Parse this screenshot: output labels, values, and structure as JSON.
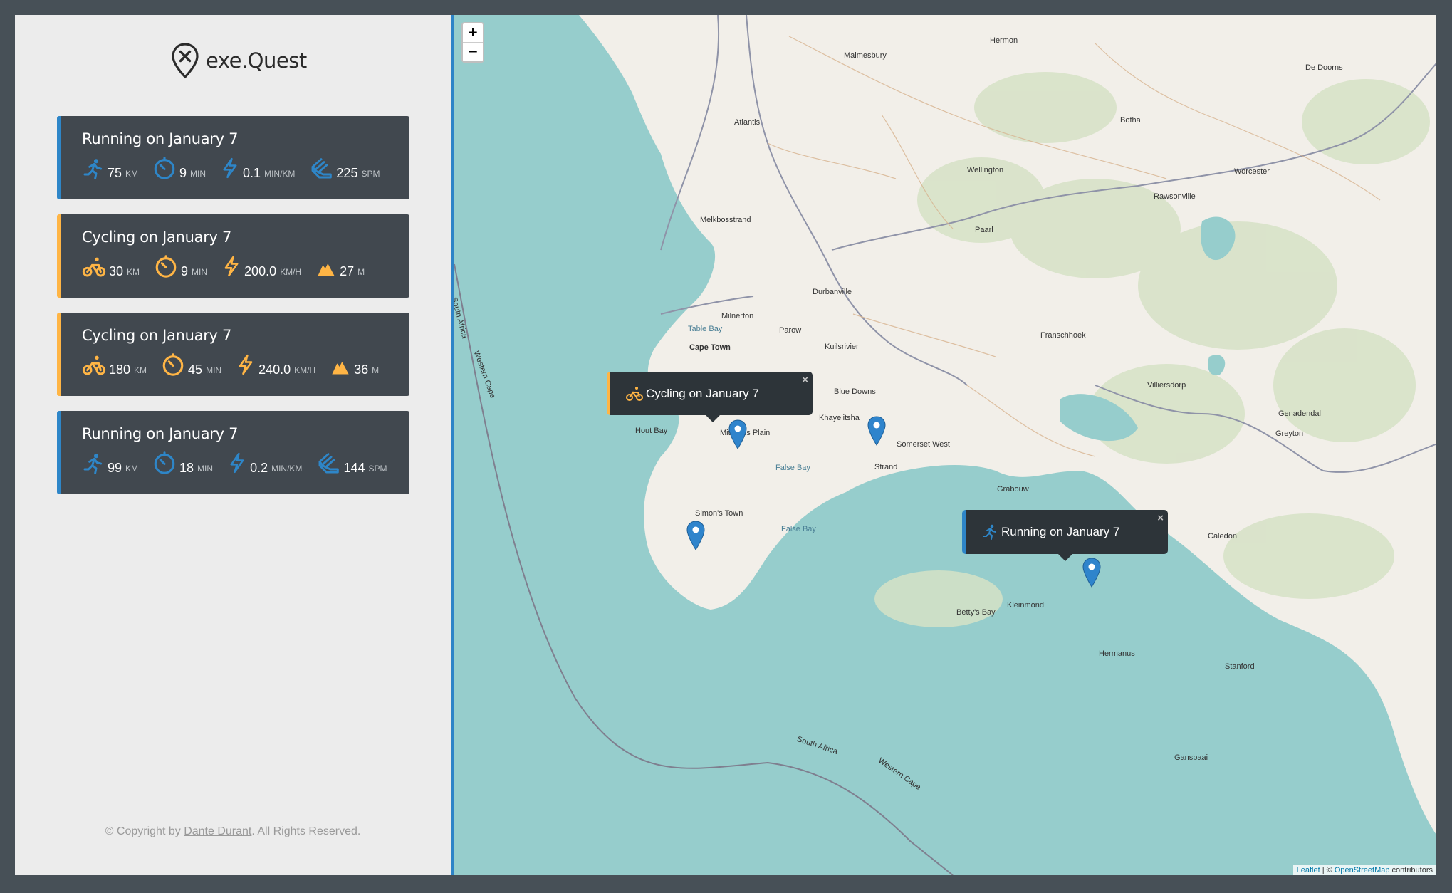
{
  "app": {
    "logo_text": "exe.Quest"
  },
  "workouts": [
    {
      "type": "running",
      "title": "Running on January 7",
      "details": [
        {
          "icon": "running-icon",
          "value": "75",
          "unit": "km"
        },
        {
          "icon": "stopwatch-icon",
          "value": "9",
          "unit": "min"
        },
        {
          "icon": "lightning-icon",
          "value": "0.1",
          "unit": "min/km"
        },
        {
          "icon": "footprint-icon",
          "value": "225",
          "unit": "spm"
        }
      ]
    },
    {
      "type": "cycling",
      "title": "Cycling on January 7",
      "details": [
        {
          "icon": "bicycle-icon",
          "value": "30",
          "unit": "km"
        },
        {
          "icon": "stopwatch-icon",
          "value": "9",
          "unit": "min"
        },
        {
          "icon": "lightning-icon",
          "value": "200.0",
          "unit": "km/h"
        },
        {
          "icon": "mountain-icon",
          "value": "27",
          "unit": "m"
        }
      ]
    },
    {
      "type": "cycling",
      "title": "Cycling on January 7",
      "details": [
        {
          "icon": "bicycle-icon",
          "value": "180",
          "unit": "km"
        },
        {
          "icon": "stopwatch-icon",
          "value": "45",
          "unit": "min"
        },
        {
          "icon": "lightning-icon",
          "value": "240.0",
          "unit": "km/h"
        },
        {
          "icon": "mountain-icon",
          "value": "36",
          "unit": "m"
        }
      ]
    },
    {
      "type": "running",
      "title": "Running on January 7",
      "details": [
        {
          "icon": "running-icon",
          "value": "99",
          "unit": "km"
        },
        {
          "icon": "stopwatch-icon",
          "value": "18",
          "unit": "min"
        },
        {
          "icon": "lightning-icon",
          "value": "0.2",
          "unit": "min/km"
        },
        {
          "icon": "footprint-icon",
          "value": "144",
          "unit": "spm"
        }
      ]
    }
  ],
  "footer": {
    "prefix": "© Copyright by",
    "author": "Dante Durant",
    "suffix": ". All Rights Reserved."
  },
  "map": {
    "zoom_in": "+",
    "zoom_out": "−",
    "popups": [
      {
        "type": "cycling",
        "text": "Cycling on January 7",
        "close": "×"
      },
      {
        "type": "running",
        "text": "Running on January 7",
        "close": "×"
      }
    ],
    "attribution": {
      "leaflet": "Leaflet",
      "sep": " | © ",
      "osm": "OpenStreetMap",
      "suffix": " contributors"
    },
    "labels": {
      "cape_town": "Cape Town",
      "false_bay": "False Bay",
      "false_bay_2": "False Bay",
      "hout_bay": "Hout Bay",
      "simons_town": "Simon's Town",
      "strand": "Strand",
      "somerset_west": "Somerset West",
      "stellenbosch_area": "Kuilsrivier",
      "paarl": "Paarl",
      "wellington": "Wellington",
      "malmesbury": "Malmesbury",
      "atlantis": "Atlantis",
      "franschhoek": "Franschhoek",
      "worcester": "Worcester",
      "kleinmond": "Kleinmond",
      "hermanus": "Hermanus",
      "gansbaai": "Gansbaai",
      "villiersdorp": "Villiersdorp",
      "grabouw": "Grabouw",
      "caledon": "Caledon",
      "stanford": "Stanford",
      "bettys_bay": "Betty's Bay",
      "hermon": "Hermon",
      "botha": "Botha",
      "rawsonville": "Rawsonville",
      "de_doorns": "De Doorns",
      "south_africa_1": "South Africa",
      "south_africa_2": "South Africa",
      "western_cape_1": "Western Cape",
      "western_cape_2": "Western Cape",
      "melkbosstrand": "Melkbosstrand",
      "durbanville": "Durbanville",
      "milnerton": "Milnerton",
      "parow": "Parow",
      "table_bay": "Table Bay",
      "blue_downs": "Blue Downs",
      "khayelitsha": "Khayelitsha",
      "mitchells_plain": "Mitchells Plain",
      "genadendal": "Genadendal",
      "greyton": "Greyton"
    }
  },
  "colors": {
    "running": "#2e86c8",
    "cycling": "#ffb545",
    "card_bg": "#41484f",
    "sea": "#96cdcc",
    "land": "#f2efe9"
  }
}
